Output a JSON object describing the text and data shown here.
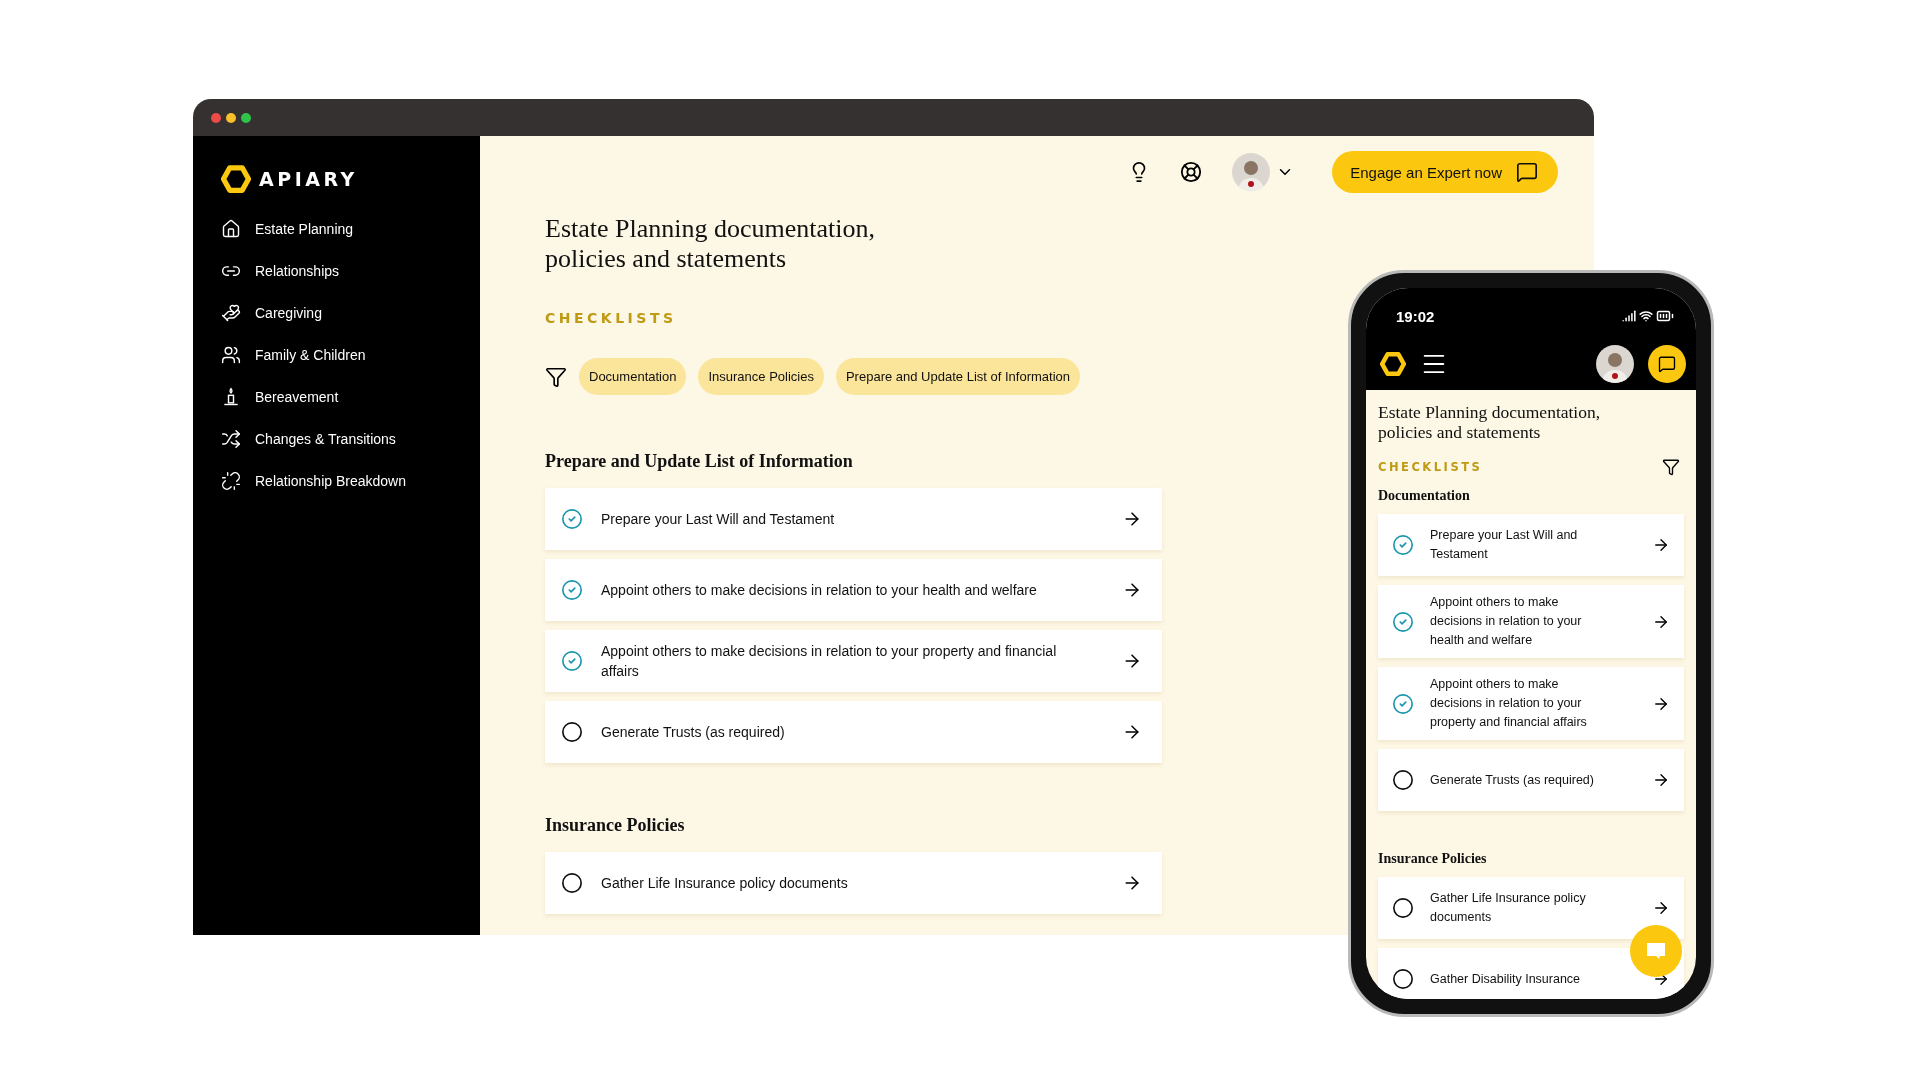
{
  "app": {
    "brand": "APIARY"
  },
  "sidebar": {
    "items": [
      {
        "label": "Estate Planning"
      },
      {
        "label": "Relationships"
      },
      {
        "label": "Caregiving"
      },
      {
        "label": "Family & Children"
      },
      {
        "label": "Bereavement"
      },
      {
        "label": "Changes & Transitions"
      },
      {
        "label": "Relationship Breakdown"
      }
    ]
  },
  "header": {
    "cta": "Engage an Expert now"
  },
  "page": {
    "title": "Estate Planning documentation,\npolicies and statements",
    "section_label": "CHECKLISTS",
    "filters": [
      {
        "label": "Documentation"
      },
      {
        "label": "Insurance Policies"
      },
      {
        "label": "Prepare and Update List of Information"
      }
    ],
    "sections": [
      {
        "heading": "Prepare and Update List of Information",
        "items": [
          {
            "text": "Prepare your Last Will and Testament",
            "done": true
          },
          {
            "text": "Appoint others to make decisions in relation to your health and welfare",
            "done": true
          },
          {
            "text": "Appoint others to make decisions in relation to your property and financial affairs",
            "done": true
          },
          {
            "text": "Generate Trusts (as required)",
            "done": false
          }
        ]
      },
      {
        "heading": "Insurance Policies",
        "items": [
          {
            "text": "Gather Life Insurance policy documents",
            "done": false
          }
        ]
      }
    ]
  },
  "phone": {
    "time": "19:02",
    "title": "Estate Planning documentation,\npolicies and statements",
    "section_label": "CHECKLISTS",
    "sections": [
      {
        "heading": "Documentation",
        "items": [
          {
            "text": "Prepare your Last Will and Testament",
            "done": true
          },
          {
            "text": "Appoint others to make decisions in relation to your health and welfare",
            "done": true
          },
          {
            "text": "Appoint others to make decisions in relation to your property and financial affairs",
            "done": true
          },
          {
            "text": "Generate Trusts (as required)",
            "done": false
          }
        ]
      },
      {
        "heading": "Insurance Policies",
        "items": [
          {
            "text": "Gather Life Insurance policy documents",
            "done": false
          },
          {
            "text": "Gather Disability Insurance",
            "done": false
          }
        ]
      }
    ]
  }
}
